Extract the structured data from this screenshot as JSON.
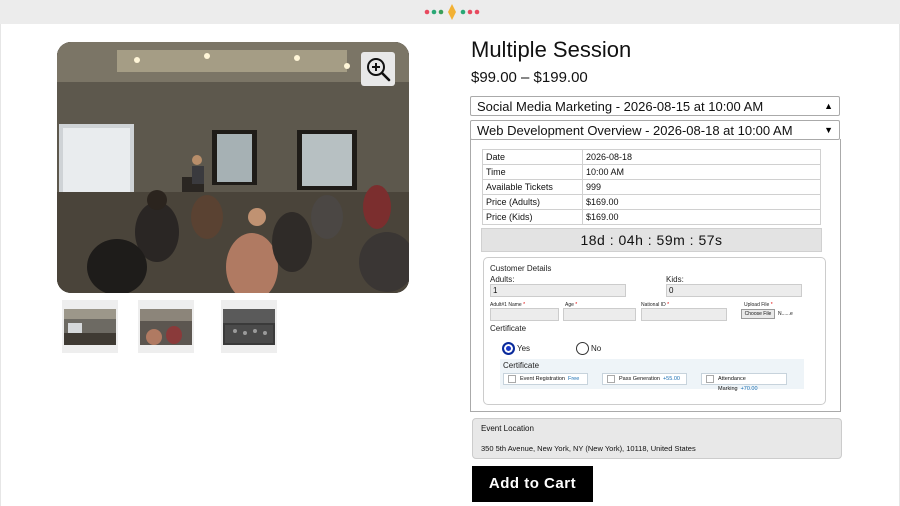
{
  "product": {
    "title": "Multiple Session",
    "price_range": "$99.00 – $199.00"
  },
  "sessions": [
    {
      "label": "Social Media Marketing - 2026-08-15 at 10:00 AM",
      "expanded": false
    },
    {
      "label": "Web Development Overview - 2026-08-18 at 10:00 AM",
      "expanded": true
    }
  ],
  "details": {
    "rows": [
      {
        "k": "Date",
        "v": "2026-08-18"
      },
      {
        "k": "Time",
        "v": "10:00 AM"
      },
      {
        "k": "Available Tickets",
        "v": "999"
      },
      {
        "k": "Price (Adults)",
        "v": "$169.00"
      },
      {
        "k": "Price (Kids)",
        "v": "$169.00"
      }
    ],
    "countdown": "18d : 04h : 59m : 57s"
  },
  "customer": {
    "heading": "Customer Details",
    "adults_label": "Adults:",
    "adults_value": "1",
    "kids_label": "Kids:",
    "kids_value": "0",
    "fields": {
      "name_label": "Adult#1 Name",
      "age_label": "Age",
      "national_id_label": "National ID",
      "upload_label": "Upload File",
      "required_mark": "*",
      "choose_file": "Choose File",
      "file_status": "N......e"
    },
    "certificate_label": "Certificate",
    "yes_label": "Yes",
    "no_label": "No",
    "yes_selected": true,
    "cert_panel_title": "Certificate",
    "cert_options": [
      {
        "label": "Event Registration",
        "price": "Free"
      },
      {
        "label": "Pass Generation",
        "price": "+55.00"
      },
      {
        "label": "Attendance Marking",
        "price": "+70.00"
      }
    ]
  },
  "location": {
    "heading": "Event Location",
    "address": "350 5th Avenue, New York, NY (New York), 10118, United States"
  },
  "add_to_cart": "Add to Cart",
  "icons": {
    "zoom": "zoom-in-icon",
    "expand": "chevron-down-icon",
    "collapse": "chevron-up-icon"
  },
  "colors": {
    "button_bg": "#000000",
    "radio_selected": "#1a38c9",
    "price_accent": "#1b6fb3"
  }
}
